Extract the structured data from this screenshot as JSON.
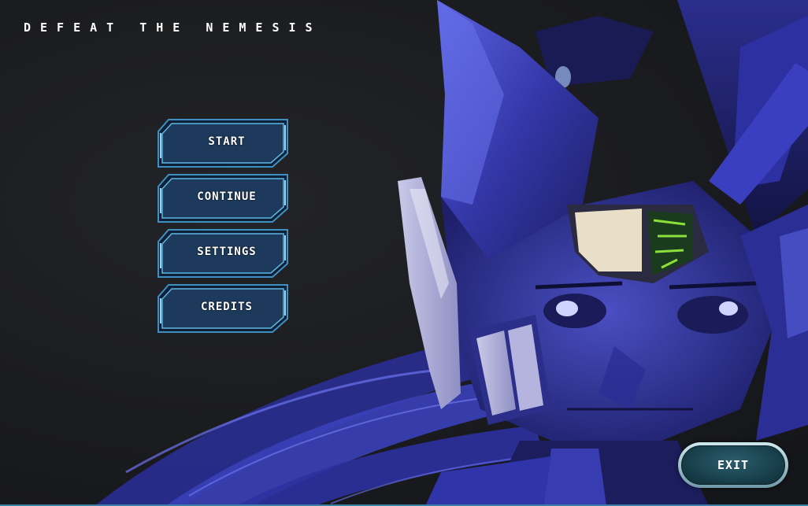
{
  "game": {
    "title": "DEFEAT THE NEMESIS"
  },
  "main_menu": {
    "items": [
      {
        "label": "START"
      },
      {
        "label": "CONTINUE"
      },
      {
        "label": "SETTINGS"
      },
      {
        "label": "CREDITS"
      }
    ]
  },
  "exit_button": {
    "label": "EXIT"
  },
  "colors": {
    "button_fill": "#1d3a5c",
    "button_border": "#5fb6e0",
    "hero_blue": "#3a3fae",
    "background": "#1a1b1e",
    "visor_green": "#8be03a"
  },
  "icons": {
    "hero": "armored-robot-hero-illustration"
  }
}
